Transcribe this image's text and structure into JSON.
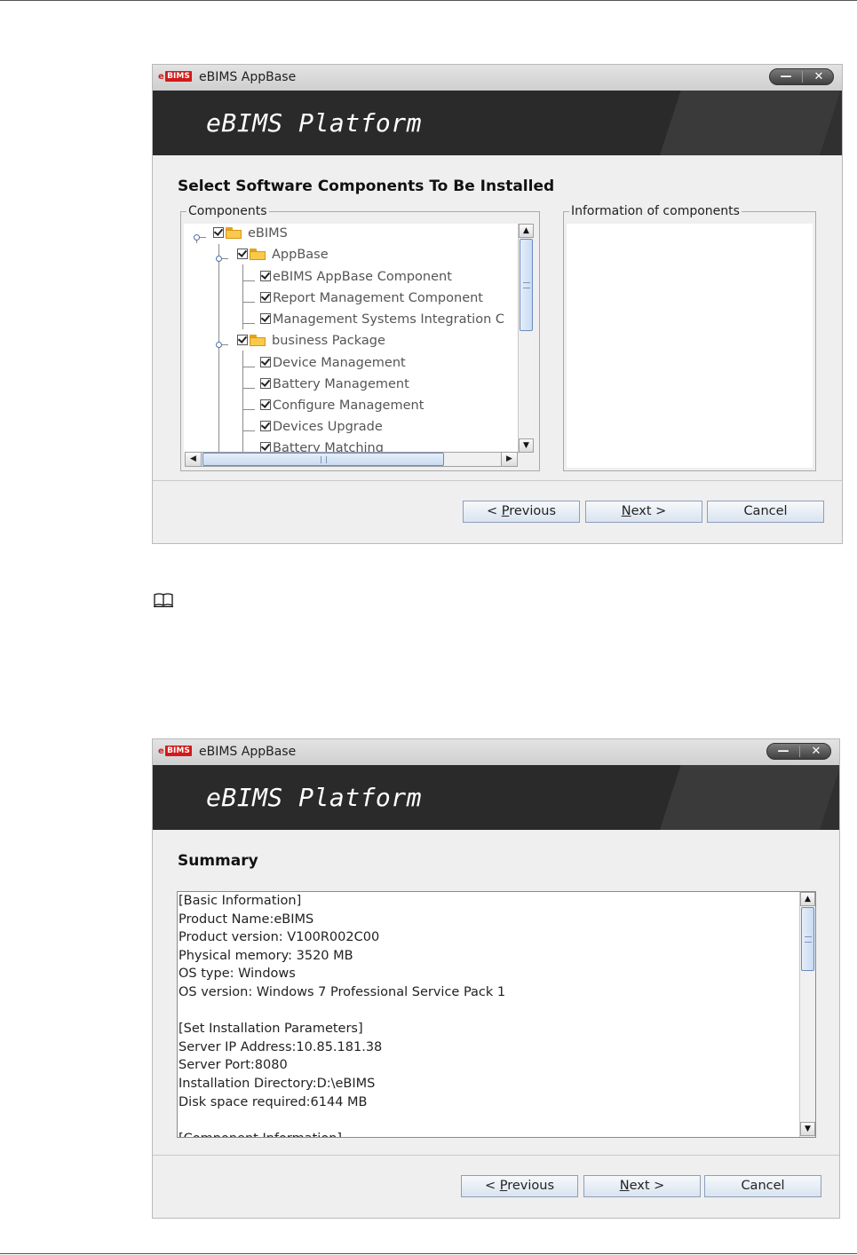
{
  "dialog1": {
    "app_title": "eBIMS AppBase",
    "logo_text": "BIMS",
    "logo_prefix": "e",
    "minimize_glyph": "—",
    "close_glyph": "✕",
    "banner_title": "eBIMS Platform",
    "section_title": "Select Software Components To Be Installed",
    "components_label": "Components",
    "info_label": "Information of components",
    "tree": [
      {
        "label": "eBIMS",
        "level": 0,
        "folder": true,
        "checked": true
      },
      {
        "label": "AppBase",
        "level": 1,
        "folder": true,
        "checked": true
      },
      {
        "label": "eBIMS AppBase Component",
        "level": 2,
        "folder": false,
        "checked": true
      },
      {
        "label": "Report Management Component",
        "level": 2,
        "folder": false,
        "checked": true
      },
      {
        "label": "Management Systems Integration C",
        "level": 2,
        "folder": false,
        "checked": true
      },
      {
        "label": "business Package",
        "level": 1,
        "folder": true,
        "checked": true
      },
      {
        "label": "Device Management",
        "level": 2,
        "folder": false,
        "checked": true
      },
      {
        "label": "Battery Management",
        "level": 2,
        "folder": false,
        "checked": true
      },
      {
        "label": "Configure Management",
        "level": 2,
        "folder": false,
        "checked": true
      },
      {
        "label": "Devices Upgrade",
        "level": 2,
        "folder": false,
        "checked": true
      },
      {
        "label": "Battery Matching",
        "level": 2,
        "folder": false,
        "checked": true
      }
    ],
    "buttons": {
      "previous": "< Previous",
      "previous_mnemonic": "P",
      "next": "Next >",
      "next_mnemonic": "N",
      "cancel": "Cancel"
    }
  },
  "note_icon": "book-icon",
  "dialog2": {
    "app_title": "eBIMS AppBase",
    "logo_text": "BIMS",
    "logo_prefix": "e",
    "minimize_glyph": "—",
    "close_glyph": "✕",
    "banner_title": "eBIMS Platform",
    "section_title": "Summary",
    "summary_lines": [
      "[Basic Information]",
      "Product Name:eBIMS",
      "Product version: V100R002C00",
      "Physical memory: 3520 MB",
      "OS type: Windows",
      "OS version: Windows 7 Professional Service Pack 1",
      "",
      "[Set Installation Parameters]",
      "Server IP Address:10.85.181.38",
      "Server Port:8080",
      "Installation Directory:D:\\eBIMS",
      "Disk space required:6144 MB",
      "",
      "[Component Information]"
    ],
    "buttons": {
      "previous": "< Previous",
      "next": "Next >",
      "cancel": "Cancel"
    }
  },
  "colors": {
    "banner": "#2a2a2a",
    "window_bg": "#efefef",
    "logo_red": "#d21a1a",
    "scroll_thumb": "#c9dbf2"
  }
}
